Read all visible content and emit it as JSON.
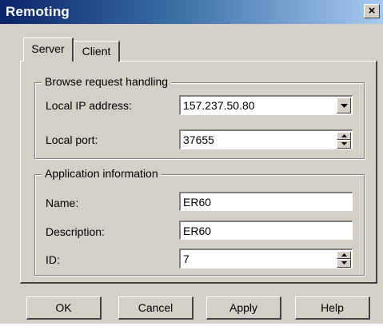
{
  "window": {
    "title": "Remoting",
    "close_label": "×"
  },
  "tabs": [
    {
      "label": "Server",
      "selected": true
    },
    {
      "label": "Client",
      "selected": false
    }
  ],
  "browse_group": {
    "title": "Browse request handling",
    "local_ip_label": "Local IP address:",
    "local_ip_value": "157.237.50.80",
    "local_port_label": "Local port:",
    "local_port_value": "37655"
  },
  "app_group": {
    "title": "Application information",
    "name_label": "Name:",
    "name_value": "ER60",
    "description_label": "Description:",
    "description_value": "ER60",
    "id_label": "ID:",
    "id_value": "7"
  },
  "buttons": {
    "ok": "OK",
    "cancel": "Cancel",
    "apply": "Apply",
    "help": "Help"
  },
  "icons": {
    "close": "close-icon",
    "dropdown": "chevron-down-icon",
    "spin_up": "spin-up-icon",
    "spin_down": "spin-down-icon"
  }
}
